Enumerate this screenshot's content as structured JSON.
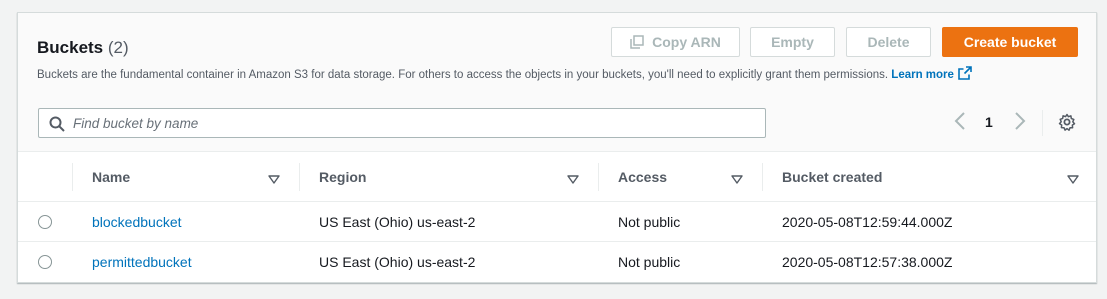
{
  "header": {
    "title": "Buckets",
    "count": "(2)",
    "description": "Buckets are the fundamental container in Amazon S3 for data storage. For others to access the objects in your buckets, you'll need to explicitly grant them permissions.",
    "learn_more": "Learn more"
  },
  "actions": {
    "copy_arn": "Copy ARN",
    "empty": "Empty",
    "delete": "Delete",
    "create_bucket": "Create bucket"
  },
  "search": {
    "placeholder": "Find bucket by name",
    "value": ""
  },
  "pagination": {
    "current_page": "1"
  },
  "table": {
    "columns": [
      "Name",
      "Region",
      "Access",
      "Bucket created"
    ],
    "rows": [
      {
        "name": "blockedbucket",
        "region": "US East (Ohio) us-east-2",
        "access": "Not public",
        "created": "2020-05-08T12:59:44.000Z"
      },
      {
        "name": "permittedbucket",
        "region": "US East (Ohio) us-east-2",
        "access": "Not public",
        "created": "2020-05-08T12:57:38.000Z"
      }
    ]
  },
  "colors": {
    "primary": "#ec7211",
    "link": "#0073bb",
    "disabled_text": "#aab7b8"
  },
  "icons": {
    "copy": "copy-icon",
    "external_link": "external-link-icon",
    "search": "search-icon",
    "prev": "chevron-left-icon",
    "next": "chevron-right-icon",
    "settings": "gear-icon",
    "sort": "sort-caret-icon"
  }
}
